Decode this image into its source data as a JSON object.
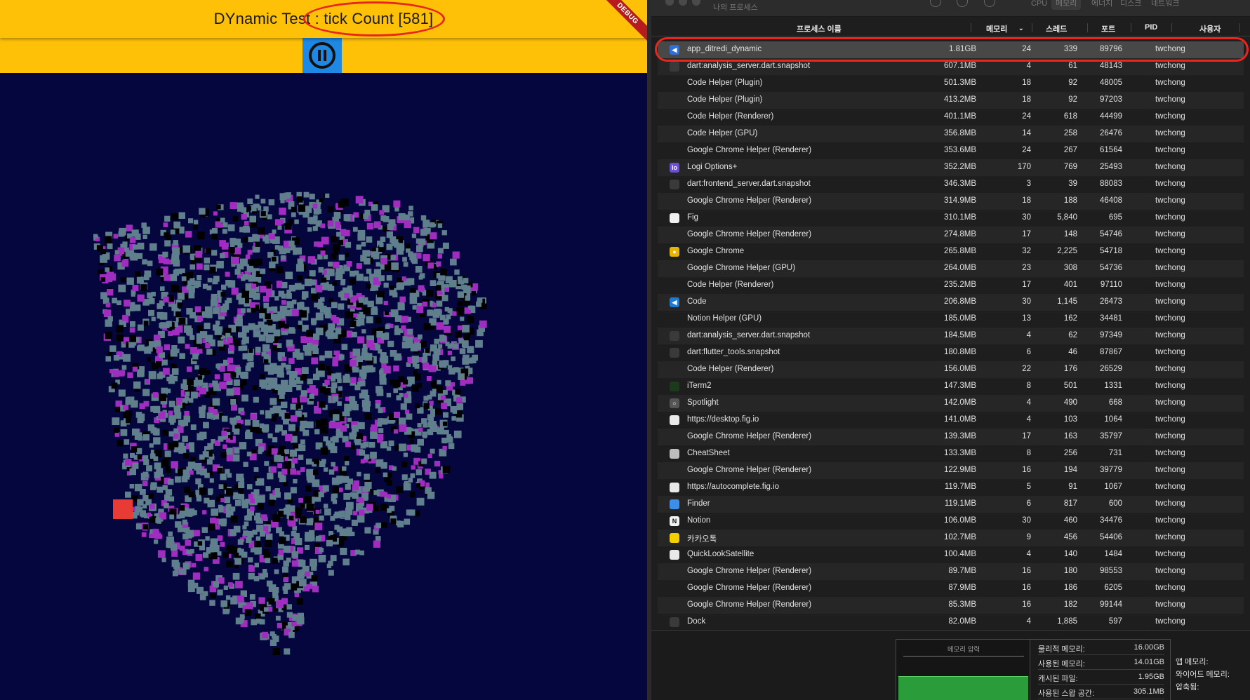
{
  "app": {
    "title": "DYnamic Test : tick Count [581]",
    "debug_banner": "DEBUG",
    "pause_icon": "pause-circle-icon",
    "colors": {
      "app_bar": "#ffc107",
      "background": "#06063f",
      "pause_button": "#1e88e5",
      "point_gray": "#5f7f8c",
      "point_magenta": "#a12cc0",
      "point_black": "#000000",
      "marker_red": "#e83b35"
    }
  },
  "monitor": {
    "window_title": "나의 프로세스",
    "segments": [
      "CPU",
      "메모리",
      "에너지",
      "디스크",
      "네트워크"
    ],
    "active_segment": "메모리",
    "columns": {
      "name": "프로세스 이름",
      "memory": "메모리",
      "threads": "스레드",
      "ports": "포트",
      "pid": "PID",
      "user": "사용자"
    },
    "processes": [
      {
        "icon": "flutter-app-icon",
        "name": "app_ditredi_dynamic",
        "memory": "1.81GB",
        "threads": "24",
        "ports": "339",
        "pid": "89796",
        "user": "twchong",
        "selected": true
      },
      {
        "icon": "terminal-icon",
        "name": "dart:analysis_server.dart.snapshot",
        "memory": "607.1MB",
        "threads": "4",
        "ports": "61",
        "pid": "48143",
        "user": "twchong"
      },
      {
        "icon": "",
        "name": "Code Helper (Plugin)",
        "memory": "501.3MB",
        "threads": "18",
        "ports": "92",
        "pid": "48005",
        "user": "twchong"
      },
      {
        "icon": "",
        "name": "Code Helper (Plugin)",
        "memory": "413.2MB",
        "threads": "18",
        "ports": "92",
        "pid": "97203",
        "user": "twchong"
      },
      {
        "icon": "",
        "name": "Code Helper (Renderer)",
        "memory": "401.1MB",
        "threads": "24",
        "ports": "618",
        "pid": "44499",
        "user": "twchong"
      },
      {
        "icon": "",
        "name": "Code Helper (GPU)",
        "memory": "356.8MB",
        "threads": "14",
        "ports": "258",
        "pid": "26476",
        "user": "twchong"
      },
      {
        "icon": "",
        "name": "Google Chrome Helper (Renderer)",
        "memory": "353.6MB",
        "threads": "24",
        "ports": "267",
        "pid": "61564",
        "user": "twchong"
      },
      {
        "icon": "logi-options-icon",
        "name": "Logi Options+",
        "memory": "352.2MB",
        "threads": "170",
        "ports": "769",
        "pid": "25493",
        "user": "twchong"
      },
      {
        "icon": "terminal-icon",
        "name": "dart:frontend_server.dart.snapshot",
        "memory": "346.3MB",
        "threads": "3",
        "ports": "39",
        "pid": "88083",
        "user": "twchong"
      },
      {
        "icon": "",
        "name": "Google Chrome Helper (Renderer)",
        "memory": "314.9MB",
        "threads": "18",
        "ports": "188",
        "pid": "46408",
        "user": "twchong"
      },
      {
        "icon": "fig-icon",
        "name": "Fig",
        "memory": "310.1MB",
        "threads": "30",
        "ports": "5,840",
        "pid": "695",
        "user": "twchong"
      },
      {
        "icon": "",
        "name": "Google Chrome Helper (Renderer)",
        "memory": "274.8MB",
        "threads": "17",
        "ports": "148",
        "pid": "54746",
        "user": "twchong"
      },
      {
        "icon": "chrome-icon",
        "name": "Google Chrome",
        "memory": "265.8MB",
        "threads": "32",
        "ports": "2,225",
        "pid": "54718",
        "user": "twchong"
      },
      {
        "icon": "",
        "name": "Google Chrome Helper (GPU)",
        "memory": "264.0MB",
        "threads": "23",
        "ports": "308",
        "pid": "54736",
        "user": "twchong"
      },
      {
        "icon": "",
        "name": "Code Helper (Renderer)",
        "memory": "235.2MB",
        "threads": "17",
        "ports": "401",
        "pid": "97110",
        "user": "twchong"
      },
      {
        "icon": "vscode-icon",
        "name": "Code",
        "memory": "206.8MB",
        "threads": "30",
        "ports": "1,145",
        "pid": "26473",
        "user": "twchong"
      },
      {
        "icon": "",
        "name": "Notion Helper (GPU)",
        "memory": "185.0MB",
        "threads": "13",
        "ports": "162",
        "pid": "34481",
        "user": "twchong"
      },
      {
        "icon": "terminal-icon",
        "name": "dart:analysis_server.dart.snapshot",
        "memory": "184.5MB",
        "threads": "4",
        "ports": "62",
        "pid": "97349",
        "user": "twchong"
      },
      {
        "icon": "terminal-icon",
        "name": "dart:flutter_tools.snapshot",
        "memory": "180.8MB",
        "threads": "6",
        "ports": "46",
        "pid": "87867",
        "user": "twchong"
      },
      {
        "icon": "",
        "name": "Code Helper (Renderer)",
        "memory": "156.0MB",
        "threads": "22",
        "ports": "176",
        "pid": "26529",
        "user": "twchong"
      },
      {
        "icon": "iterm-icon",
        "name": "iTerm2",
        "memory": "147.3MB",
        "threads": "8",
        "ports": "501",
        "pid": "1331",
        "user": "twchong"
      },
      {
        "icon": "spotlight-icon",
        "name": "Spotlight",
        "memory": "142.0MB",
        "threads": "4",
        "ports": "490",
        "pid": "668",
        "user": "twchong"
      },
      {
        "icon": "shield-icon",
        "name": "https://desktop.fig.io",
        "memory": "141.0MB",
        "threads": "4",
        "ports": "103",
        "pid": "1064",
        "user": "twchong"
      },
      {
        "icon": "",
        "name": "Google Chrome Helper (Renderer)",
        "memory": "139.3MB",
        "threads": "17",
        "ports": "163",
        "pid": "35797",
        "user": "twchong"
      },
      {
        "icon": "cheatsheet-icon",
        "name": "CheatSheet",
        "memory": "133.3MB",
        "threads": "8",
        "ports": "256",
        "pid": "731",
        "user": "twchong"
      },
      {
        "icon": "",
        "name": "Google Chrome Helper (Renderer)",
        "memory": "122.9MB",
        "threads": "16",
        "ports": "194",
        "pid": "39779",
        "user": "twchong"
      },
      {
        "icon": "shield-icon",
        "name": "https://autocomplete.fig.io",
        "memory": "119.7MB",
        "threads": "5",
        "ports": "91",
        "pid": "1067",
        "user": "twchong"
      },
      {
        "icon": "finder-icon",
        "name": "Finder",
        "memory": "119.1MB",
        "threads": "6",
        "ports": "817",
        "pid": "600",
        "user": "twchong"
      },
      {
        "icon": "notion-icon",
        "name": "Notion",
        "memory": "106.0MB",
        "threads": "30",
        "ports": "460",
        "pid": "34476",
        "user": "twchong"
      },
      {
        "icon": "kakaotalk-icon",
        "name": "카카오톡",
        "memory": "102.7MB",
        "threads": "9",
        "ports": "456",
        "pid": "54406",
        "user": "twchong"
      },
      {
        "icon": "shield-icon",
        "name": "QuickLookSatellite",
        "memory": "100.4MB",
        "threads": "4",
        "ports": "140",
        "pid": "1484",
        "user": "twchong"
      },
      {
        "icon": "",
        "name": "Google Chrome Helper (Renderer)",
        "memory": "89.7MB",
        "threads": "16",
        "ports": "180",
        "pid": "98553",
        "user": "twchong"
      },
      {
        "icon": "",
        "name": "Google Chrome Helper (Renderer)",
        "memory": "87.9MB",
        "threads": "16",
        "ports": "186",
        "pid": "6205",
        "user": "twchong"
      },
      {
        "icon": "",
        "name": "Google Chrome Helper (Renderer)",
        "memory": "85.3MB",
        "threads": "16",
        "ports": "182",
        "pid": "99144",
        "user": "twchong"
      },
      {
        "icon": "dock-icon",
        "name": "Dock",
        "memory": "82.0MB",
        "threads": "4",
        "ports": "1,885",
        "pid": "597",
        "user": "twchong"
      }
    ],
    "pressure_title": "메모리 압력",
    "stats": [
      {
        "label": "물리적 메모리:",
        "value": "16.00GB"
      },
      {
        "label": "사용된 메모리:",
        "value": "14.01GB"
      },
      {
        "label": "캐시된 파일:",
        "value": "1.95GB"
      },
      {
        "label": "사용된 스왑 공간:",
        "value": "305.1MB"
      }
    ],
    "stats2": [
      "앱 메모리:",
      "와이어드 메모리:",
      "압축됨:"
    ]
  }
}
